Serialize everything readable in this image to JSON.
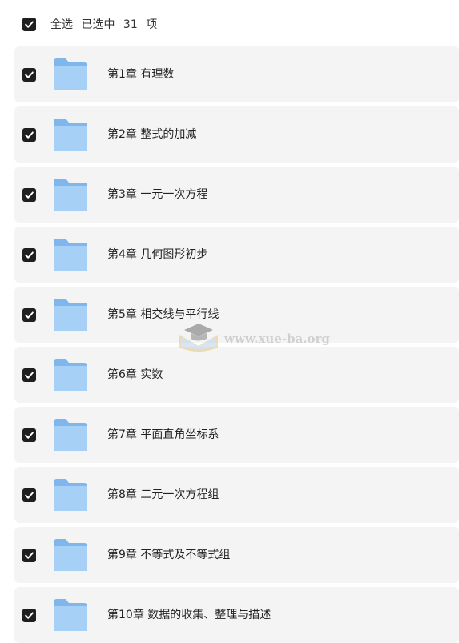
{
  "header": {
    "select_all_label": "全选",
    "selected_prefix": "已选中",
    "selected_count": "31",
    "selected_suffix": "项"
  },
  "items": [
    {
      "label": "第1章 有理数",
      "checked": true,
      "icon": "folder-icon"
    },
    {
      "label": "第2章 整式的加减",
      "checked": true,
      "icon": "folder-icon"
    },
    {
      "label": "第3章 一元一次方程",
      "checked": true,
      "icon": "folder-icon"
    },
    {
      "label": "第4章 几何图形初步",
      "checked": true,
      "icon": "folder-icon"
    },
    {
      "label": "第5章 相交线与平行线",
      "checked": true,
      "icon": "folder-icon"
    },
    {
      "label": "第6章 实数",
      "checked": true,
      "icon": "folder-icon"
    },
    {
      "label": "第7章 平面直角坐标系",
      "checked": true,
      "icon": "folder-icon"
    },
    {
      "label": "第8章 二元一次方程组",
      "checked": true,
      "icon": "folder-icon"
    },
    {
      "label": "第9章 不等式及不等式组",
      "checked": true,
      "icon": "folder-icon"
    },
    {
      "label": "第10章 数据的收集、整理与描述",
      "checked": true,
      "icon": "folder-icon"
    }
  ],
  "watermark": {
    "text": "www.xue-ba.org"
  },
  "colors": {
    "checkbox": "#1f1f1f",
    "row_bg": "#f4f4f5",
    "folder_back": "#7fb6ec",
    "folder_front": "#a6d0f6"
  }
}
